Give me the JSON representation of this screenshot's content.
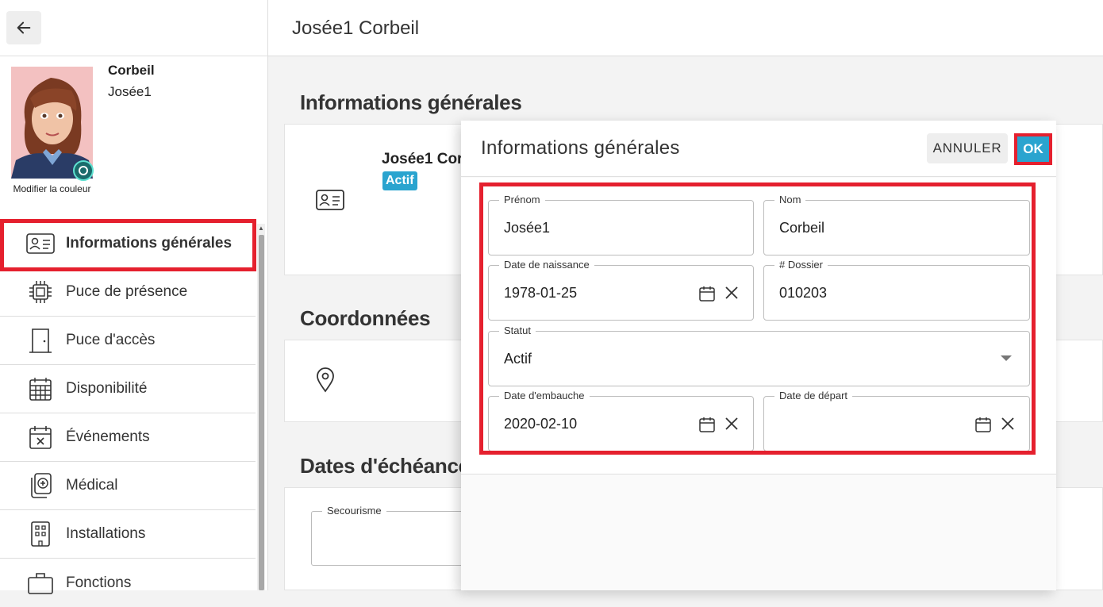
{
  "header": {
    "title": "Josée1 Corbeil"
  },
  "profile": {
    "last_name": "Corbeil",
    "first_name": "Josée1",
    "modify_color": "Modifier la couleur"
  },
  "nav": {
    "items": [
      {
        "label": "Informations générales",
        "icon": "id-card-icon",
        "selected": true
      },
      {
        "label": "Puce de présence",
        "icon": "chip-icon"
      },
      {
        "label": "Puce d'accès",
        "icon": "door-icon"
      },
      {
        "label": "Disponibilité",
        "icon": "calendar-grid-icon"
      },
      {
        "label": "Événements",
        "icon": "calendar-x-icon"
      },
      {
        "label": "Médical",
        "icon": "medical-icon"
      },
      {
        "label": "Installations",
        "icon": "building-icon"
      },
      {
        "label": "Fonctions",
        "icon": "briefcase-icon"
      }
    ]
  },
  "sections": {
    "general": "Informations générales",
    "coords": "Coordonnées",
    "due_dates": "Dates d'échéance"
  },
  "card": {
    "name": "Josée1 Cor",
    "status_badge": "Actif"
  },
  "due_dates": {
    "secourisme_label": "Secourisme"
  },
  "dialog": {
    "title": "Informations générales",
    "cancel_label": "ANNULER",
    "ok_label": "OK",
    "fields": {
      "prenom": {
        "label": "Prénom",
        "value": "Josée1"
      },
      "nom": {
        "label": "Nom",
        "value": "Corbeil"
      },
      "date_naissance": {
        "label": "Date de naissance",
        "value": "1978-01-25"
      },
      "dossier": {
        "label": "# Dossier",
        "value": "010203"
      },
      "statut": {
        "label": "Statut",
        "value": "Actif"
      },
      "date_embauche": {
        "label": "Date d'embauche",
        "value": "2020-02-10"
      },
      "date_depart": {
        "label": "Date de départ",
        "value": ""
      }
    }
  },
  "colors": {
    "accent": "#2aa4cf",
    "highlight": "#e5202e"
  }
}
